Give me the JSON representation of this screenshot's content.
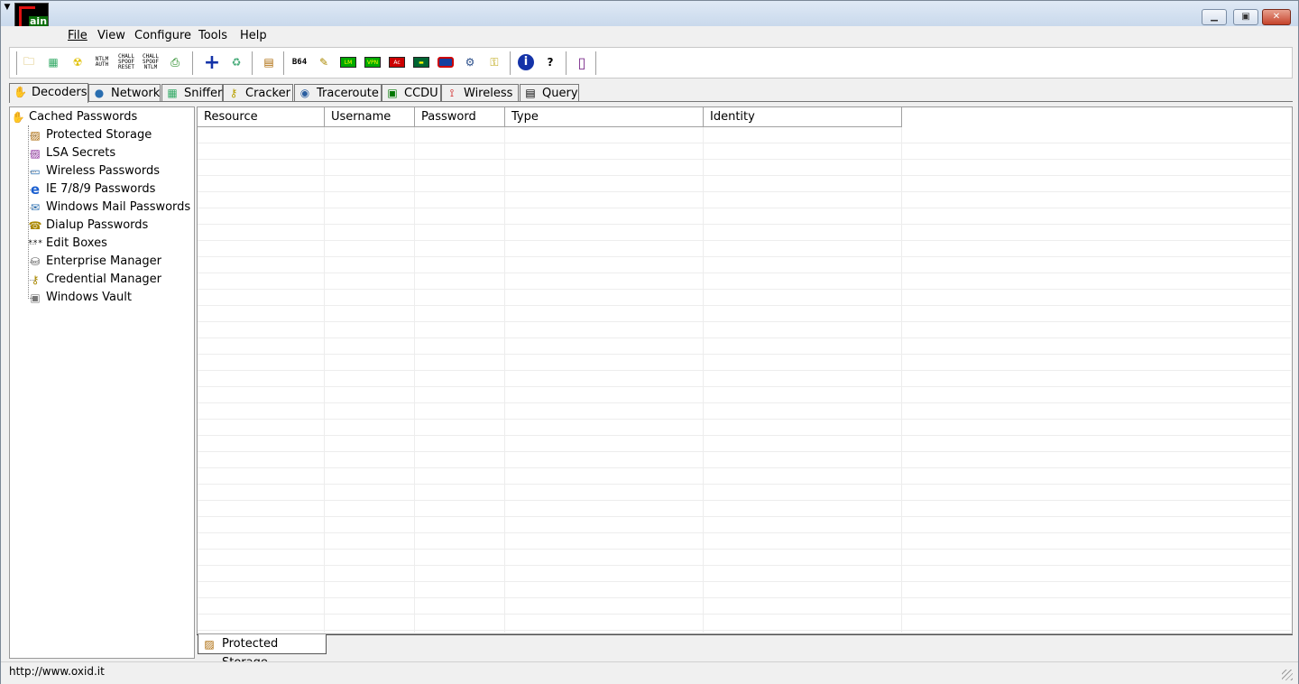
{
  "app": {
    "logo_text": "ain",
    "window_buttons": [
      "minimize",
      "restore",
      "close"
    ]
  },
  "menu": [
    "File",
    "View",
    "Configure",
    "Tools",
    "Help"
  ],
  "toolbar": {
    "ntlm_auth": "NTLM AUTH",
    "chall_spoof_reset": "CHALL SPOOF RESET",
    "chall_spoof_ntlm": "CHALL SPOOF NTLM",
    "b64": "B64",
    "lm": "LM",
    "vpn": "VPN"
  },
  "tabs": [
    {
      "label": "Decoders",
      "icon": "decoders-icon"
    },
    {
      "label": "Network",
      "icon": "network-icon"
    },
    {
      "label": "Sniffer",
      "icon": "sniffer-icon"
    },
    {
      "label": "Cracker",
      "icon": "cracker-icon"
    },
    {
      "label": "Traceroute",
      "icon": "traceroute-icon"
    },
    {
      "label": "CCDU",
      "icon": "ccdu-icon"
    },
    {
      "label": "Wireless",
      "icon": "wireless-icon"
    },
    {
      "label": "Query",
      "icon": "query-icon"
    }
  ],
  "active_tab": "Decoders",
  "tree": {
    "root": "Cached Passwords",
    "items": [
      "Protected Storage",
      "LSA Secrets",
      "Wireless Passwords",
      "IE 7/8/9 Passwords",
      "Windows Mail Passwords",
      "Dialup Passwords",
      "Edit Boxes",
      "Enterprise Manager",
      "Credential Manager",
      "Windows Vault"
    ]
  },
  "table": {
    "columns": [
      "Resource",
      "Username",
      "Password",
      "Type",
      "Identity"
    ],
    "rows": []
  },
  "bottom_tab": "Protected Storage",
  "status": "http://www.oxid.it",
  "colors": {
    "logo_red": "#e01010",
    "close_button": "#c5432b",
    "ie_blue": "#1a5fd0"
  }
}
